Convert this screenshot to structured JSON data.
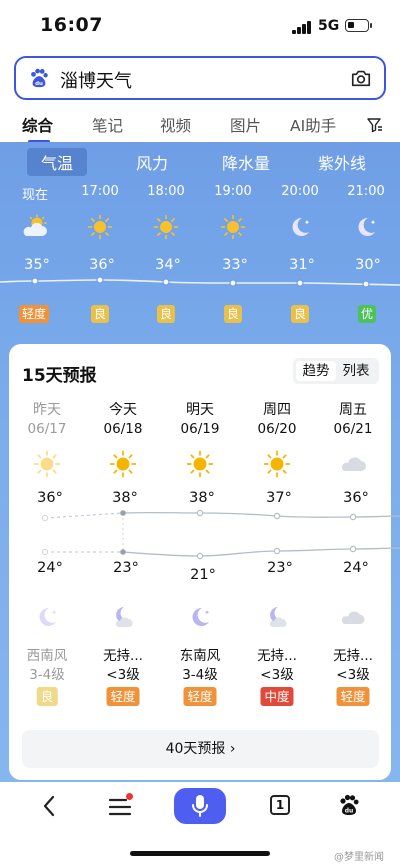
{
  "status_bar": {
    "time": "16:07",
    "network": "5G"
  },
  "search": {
    "query": "淄博天气"
  },
  "tabs": [
    "综合",
    "笔记",
    "视频",
    "图片",
    "AI助手"
  ],
  "metric_tabs": [
    "气温",
    "风力",
    "降水量",
    "紫外线"
  ],
  "hourly": [
    {
      "time": "现在",
      "temp": "35°",
      "aqi": "轻度",
      "icon": "partly-cloudy-icon"
    },
    {
      "time": "17:00",
      "temp": "36°",
      "aqi": "良",
      "icon": "sun-icon"
    },
    {
      "time": "18:00",
      "temp": "34°",
      "aqi": "良",
      "icon": "sun-icon"
    },
    {
      "time": "19:00",
      "temp": "33°",
      "aqi": "良",
      "icon": "sun-icon"
    },
    {
      "time": "20:00",
      "temp": "31°",
      "aqi": "良",
      "icon": "moon-icon"
    },
    {
      "time": "21:00",
      "temp": "30°",
      "aqi": "优",
      "icon": "moon-icon"
    }
  ],
  "forecast": {
    "title": "15天预报",
    "toggle": [
      "趋势",
      "列表"
    ],
    "days": [
      {
        "name": "昨天",
        "date": "06/17",
        "high": "36°",
        "low": "24°",
        "wind": "西南风",
        "level": "3-4级",
        "aqi": "良",
        "day_icon": "sun-icon",
        "night_icon": "moon-icon"
      },
      {
        "name": "今天",
        "date": "06/18",
        "high": "38°",
        "low": "23°",
        "wind": "无持...",
        "level": "<3级",
        "aqi": "轻度",
        "day_icon": "sun-icon",
        "night_icon": "moon-cloud-icon"
      },
      {
        "name": "明天",
        "date": "06/19",
        "high": "38°",
        "low": "21°",
        "wind": "东南风",
        "level": "3-4级",
        "aqi": "轻度",
        "day_icon": "sun-icon",
        "night_icon": "moon-icon"
      },
      {
        "name": "周四",
        "date": "06/20",
        "high": "37°",
        "low": "23°",
        "wind": "无持...",
        "level": "<3级",
        "aqi": "中度",
        "day_icon": "sun-icon",
        "night_icon": "moon-cloud-icon"
      },
      {
        "name": "周五",
        "date": "06/21",
        "high": "36°",
        "low": "24°",
        "wind": "无持...",
        "level": "<3级",
        "aqi": "轻度",
        "day_icon": "cloud-icon",
        "night_icon": "cloud-icon"
      }
    ],
    "more_label": "40天预报 ›"
  },
  "colors": {
    "accent": "#3d55e0",
    "aqi_good": "#e8c04a",
    "aqi_light": "#f0923a",
    "aqi_moderate": "#e04a3a",
    "aqi_excellent": "#4cc25a"
  },
  "nav": {
    "tabs_count": "1"
  },
  "watermark": "@梦里新闻"
}
